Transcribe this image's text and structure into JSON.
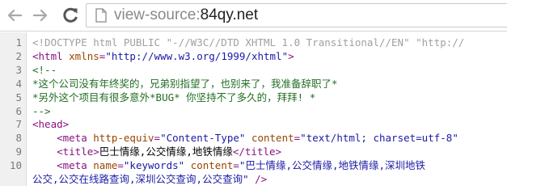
{
  "browser": {
    "back_icon": "back-arrow-icon",
    "forward_icon": "forward-arrow-icon",
    "reload_icon": "reload-icon",
    "page_icon": "page-icon",
    "url_scheme": "view-source:",
    "url_host": "84qy.net"
  },
  "source_lines": [
    {
      "num": "1",
      "parts": [
        {
          "cls": "doctype",
          "text": "<!DOCTYPE html PUBLIC \"-//W3C//DTD XHTML 1.0 Transitional//EN\" \"http://"
        }
      ]
    },
    {
      "num": "2",
      "parts": [
        {
          "cls": "tag",
          "text": "<html "
        },
        {
          "cls": "attr",
          "text": "xmlns"
        },
        {
          "cls": "tag",
          "text": "="
        },
        {
          "cls": "val",
          "text": "\"http://www.w3.org/1999/xhtml\""
        },
        {
          "cls": "tag",
          "text": ">"
        }
      ]
    },
    {
      "num": "3",
      "parts": [
        {
          "cls": "comment",
          "text": "<!--"
        }
      ]
    },
    {
      "num": "4",
      "parts": [
        {
          "cls": "comment",
          "text": "*这个公司没有年终奖的，兄弟别指望了，也别来了，我准备辞职了*"
        }
      ]
    },
    {
      "num": "5",
      "parts": [
        {
          "cls": "comment",
          "text": "*另外这个项目有很多意外*BUG* 你坚持不了多久的，拜拜! *"
        }
      ]
    },
    {
      "num": "6",
      "parts": [
        {
          "cls": "comment",
          "text": "-->"
        }
      ]
    },
    {
      "num": "7",
      "parts": [
        {
          "cls": "tag",
          "text": "<head>"
        }
      ]
    },
    {
      "num": "8",
      "parts": [
        {
          "cls": "txt",
          "text": "    "
        },
        {
          "cls": "tag",
          "text": "<meta "
        },
        {
          "cls": "attr",
          "text": "http-equiv"
        },
        {
          "cls": "tag",
          "text": "="
        },
        {
          "cls": "val",
          "text": "\"Content-Type\""
        },
        {
          "cls": "tag",
          "text": " "
        },
        {
          "cls": "attr",
          "text": "content"
        },
        {
          "cls": "tag",
          "text": "="
        },
        {
          "cls": "val",
          "text": "\"text/html; charset=utf-8\""
        }
      ]
    },
    {
      "num": "9",
      "parts": [
        {
          "cls": "txt",
          "text": "    "
        },
        {
          "cls": "tag",
          "text": "<title>"
        },
        {
          "cls": "txt",
          "text": "巴士情缘,公交情缘,地铁情缘"
        },
        {
          "cls": "tag",
          "text": "</title>"
        }
      ]
    },
    {
      "num": "10",
      "parts": [
        {
          "cls": "txt",
          "text": "    "
        },
        {
          "cls": "tag",
          "text": "<meta "
        },
        {
          "cls": "attr",
          "text": "name"
        },
        {
          "cls": "tag",
          "text": "="
        },
        {
          "cls": "val",
          "text": "\"keywords\""
        },
        {
          "cls": "tag",
          "text": " "
        },
        {
          "cls": "attr",
          "text": "content"
        },
        {
          "cls": "tag",
          "text": "="
        },
        {
          "cls": "val",
          "text": "\"巴士情缘,公交情缘,地铁情缘,深圳地铁"
        }
      ]
    },
    {
      "num": "",
      "parts": [
        {
          "cls": "val",
          "text": "公交,公交在线路查询,深圳公交查询,公交查询\""
        },
        {
          "cls": "tag",
          "text": " />"
        }
      ]
    }
  ]
}
